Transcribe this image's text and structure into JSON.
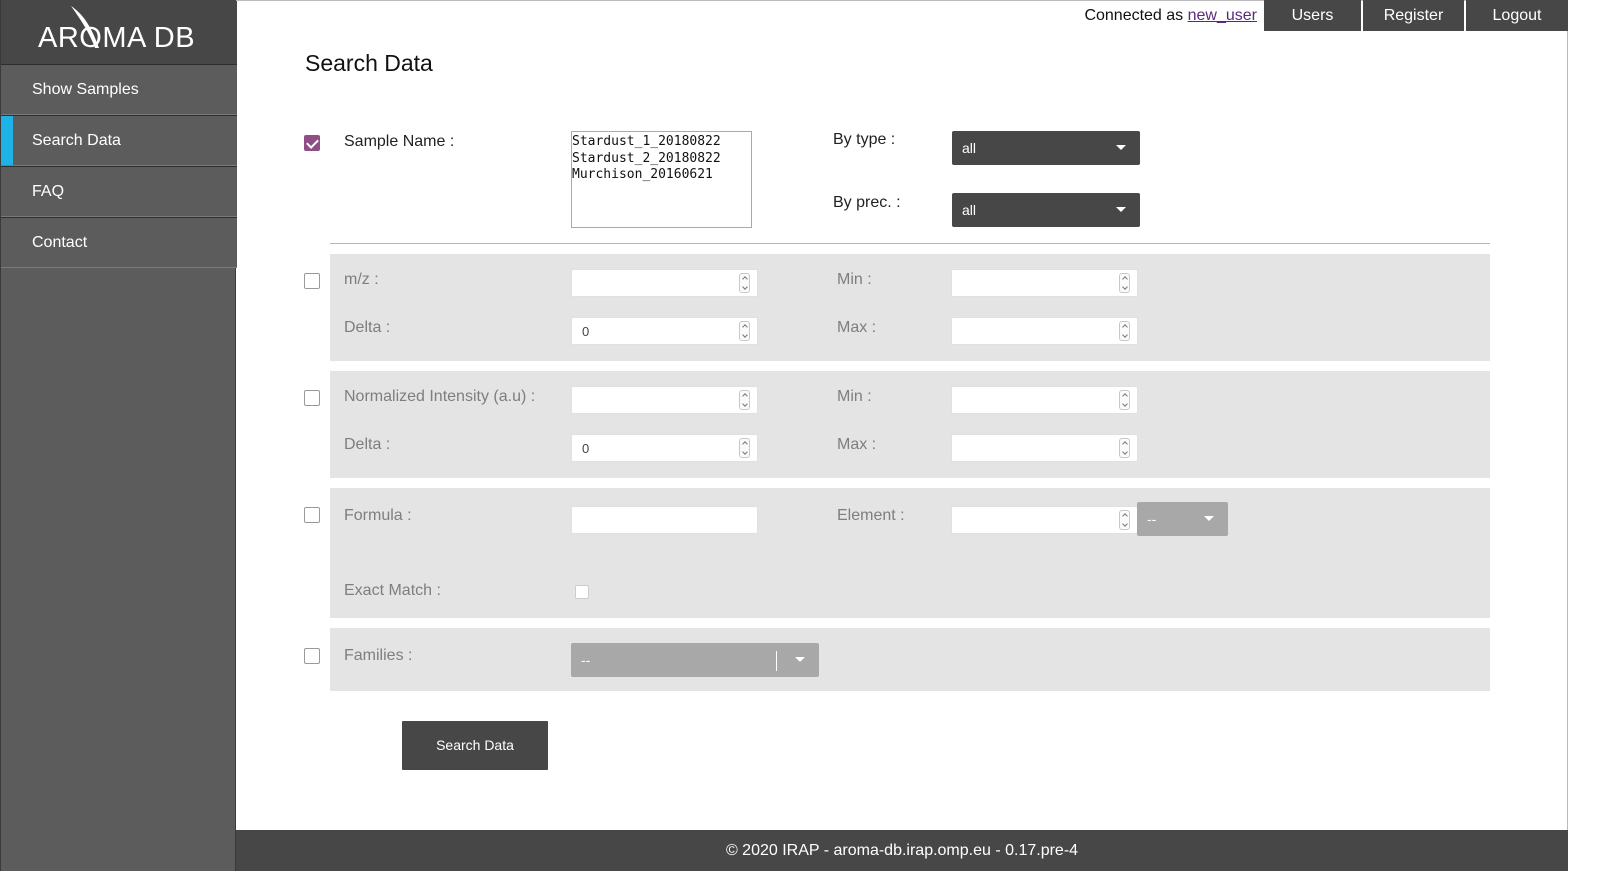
{
  "sidebar": {
    "logo": "AROMA DB",
    "items": [
      {
        "label": "Show Samples"
      },
      {
        "label": "Search Data"
      },
      {
        "label": "FAQ"
      },
      {
        "label": "Contact"
      }
    ]
  },
  "topbar": {
    "connected_prefix": "Connected as",
    "username": "new_user",
    "buttons": [
      "Users",
      "Register",
      "Logout"
    ]
  },
  "page": {
    "title": "Search Data"
  },
  "sample": {
    "checked": true,
    "label": "Sample Name :",
    "options": [
      "Stardust_1_20180822",
      "Stardust_2_20180822",
      "Murchison_20160621"
    ],
    "by_type_label": "By type :",
    "by_type_value": "all",
    "by_prec_label": "By prec. :",
    "by_prec_value": "all"
  },
  "mz": {
    "label": "m/z :",
    "delta_label": "Delta :",
    "delta_value": "0",
    "min_label": "Min :",
    "max_label": "Max :"
  },
  "intensity": {
    "label": "Normalized Intensity (a.u) :",
    "delta_label": "Delta :",
    "delta_value": "0",
    "min_label": "Min :",
    "max_label": "Max :"
  },
  "formula": {
    "label": "Formula :",
    "element_label": "Element :",
    "element_select": "--",
    "exact_label": "Exact Match :"
  },
  "families": {
    "label": "Families :",
    "select": "--"
  },
  "actions": {
    "search_label": "Search Data"
  },
  "footer": {
    "text": "© 2020 IRAP - aroma-db.irap.omp.eu - 0.17.pre-4"
  },
  "colors": {
    "sidebar": "#5c5c5c",
    "dark": "#474747",
    "accent": "#1eb3e6",
    "check": "#8d4f86",
    "panel": "#e4e4e4"
  }
}
